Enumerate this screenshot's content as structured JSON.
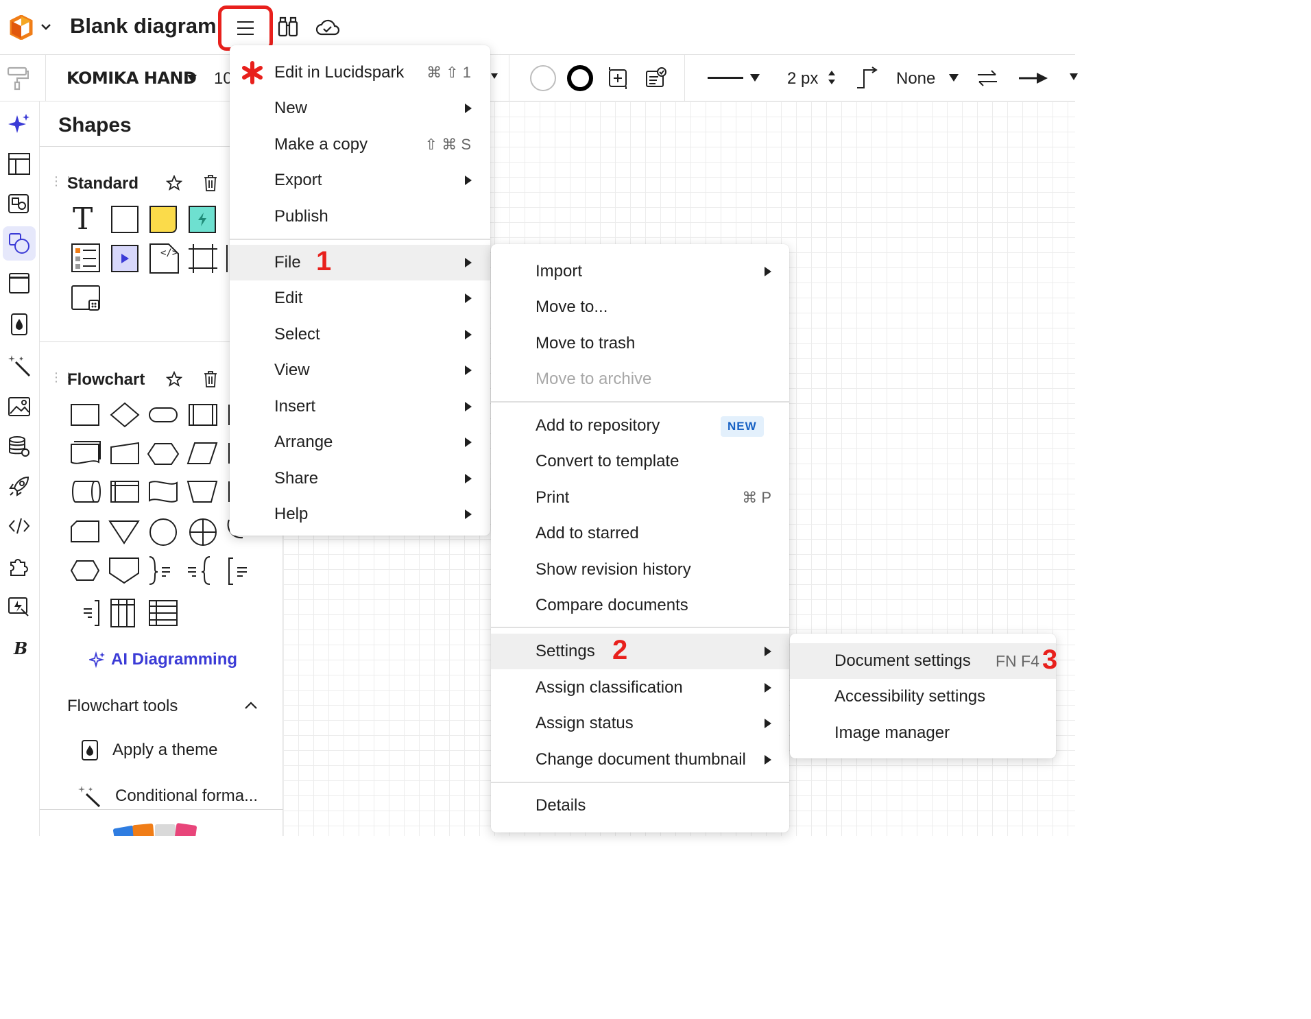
{
  "app": {
    "doc_title": "Blank diagram"
  },
  "toolbar": {
    "font": "KOMIKA HAND",
    "font_size": "10",
    "line_width": "2 px",
    "arrow_start": "None"
  },
  "shapes_panel": {
    "title": "Shapes",
    "standard_title": "Standard",
    "flowchart_title": "Flowchart",
    "ai_diagramming": "AI Diagramming",
    "flowchart_tools": "Flowchart tools",
    "apply_theme": "Apply a theme",
    "conditional_formatting": "Conditional forma..."
  },
  "main_menu": {
    "items": [
      {
        "label": "Edit in Lucidspark",
        "shortcut": "⌘ ⇧ 1"
      },
      {
        "label": "New"
      },
      {
        "label": "Make a copy",
        "shortcut": "⇧ ⌘ S"
      },
      {
        "label": "Export"
      },
      {
        "label": "Publish"
      },
      {
        "label": "File",
        "step": "1"
      },
      {
        "label": "Edit"
      },
      {
        "label": "Select"
      },
      {
        "label": "View"
      },
      {
        "label": "Insert"
      },
      {
        "label": "Arrange"
      },
      {
        "label": "Share"
      },
      {
        "label": "Help"
      }
    ]
  },
  "file_menu": {
    "items": [
      {
        "label": "Import"
      },
      {
        "label": "Move to..."
      },
      {
        "label": "Move to trash"
      },
      {
        "label": "Move to archive"
      },
      {
        "label": "Add to repository",
        "badge": "NEW"
      },
      {
        "label": "Convert to template"
      },
      {
        "label": "Print",
        "shortcut": "⌘ P"
      },
      {
        "label": "Add to starred"
      },
      {
        "label": "Show revision history"
      },
      {
        "label": "Compare documents"
      },
      {
        "label": "Settings",
        "step": "2"
      },
      {
        "label": "Assign classification"
      },
      {
        "label": "Assign status"
      },
      {
        "label": "Change document thumbnail"
      },
      {
        "label": "Details"
      }
    ]
  },
  "settings_menu": {
    "items": [
      {
        "label": "Document settings",
        "shortcut": "FN F4",
        "step": "3"
      },
      {
        "label": "Accessibility settings"
      },
      {
        "label": "Image manager"
      }
    ]
  },
  "colors": {
    "highlight_red": "#e8201c",
    "accent_blue": "#3b3bd6",
    "logo_orange": "#f07d17"
  }
}
